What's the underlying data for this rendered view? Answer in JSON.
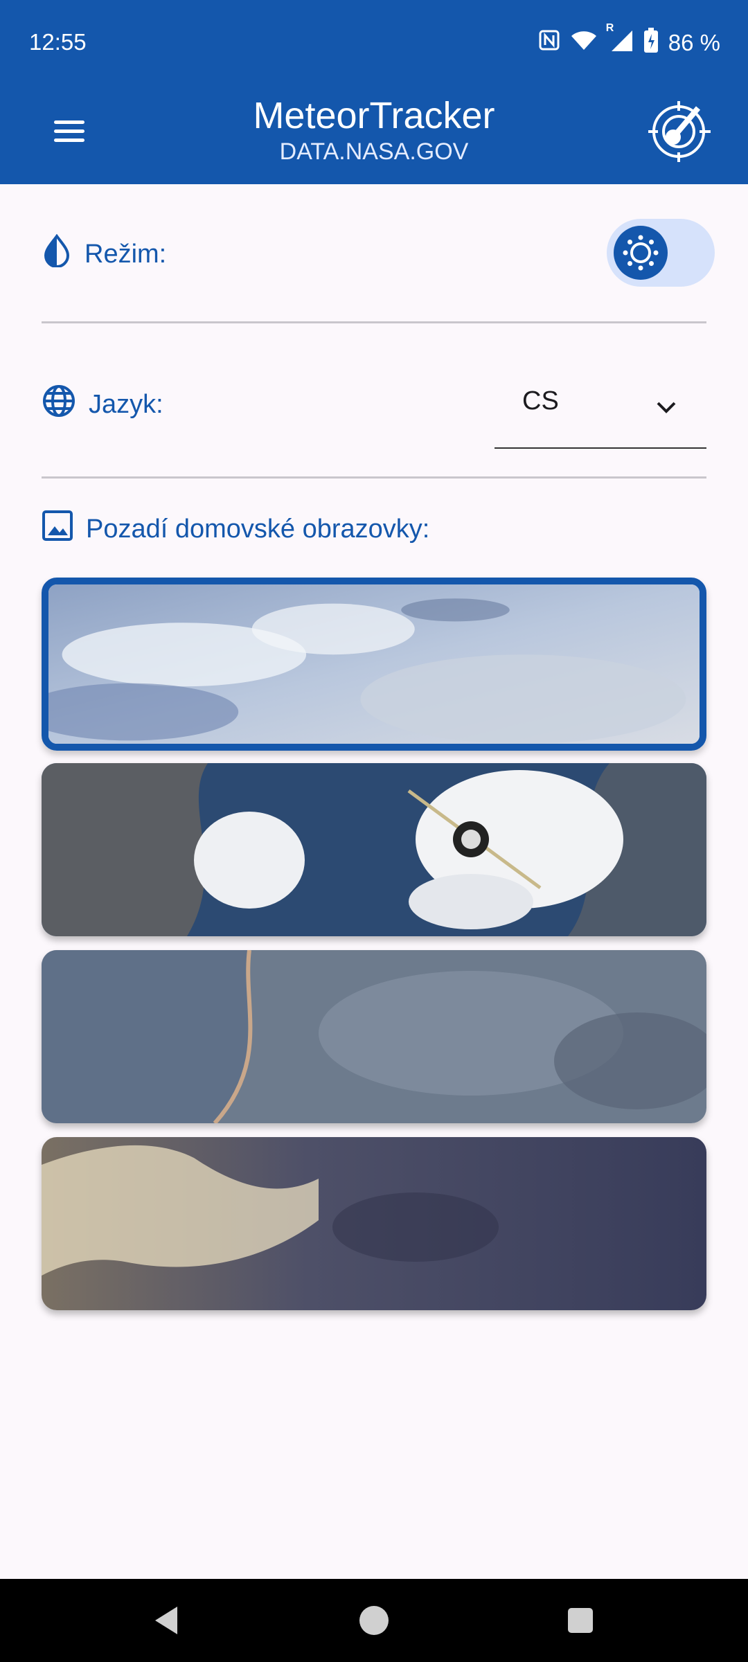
{
  "status": {
    "time": "12:55",
    "battery": "86 %",
    "roaming": "R"
  },
  "appbar": {
    "title": "MeteorTracker",
    "subtitle": "DATA.NASA.GOV"
  },
  "settings": {
    "mode_label": "Režim:",
    "language_label": "Jazyk:",
    "language_value": "CS",
    "background_label": "Pozadí domovské obrazovky:"
  },
  "backgrounds": {
    "selected_index": 0,
    "items": [
      "earth-clouds",
      "spacecraft-over-earth",
      "planet-surface-coast",
      "mars-terrain"
    ]
  },
  "colors": {
    "primary": "#1457ac",
    "surface": "#fcf8fc",
    "toggle_track": "#d6e2fb"
  },
  "icons": {
    "mode": "half-drop-icon",
    "language": "globe-icon",
    "background": "image-icon",
    "theme_toggle": "sun-icon",
    "logo": "meteor-target-icon"
  }
}
